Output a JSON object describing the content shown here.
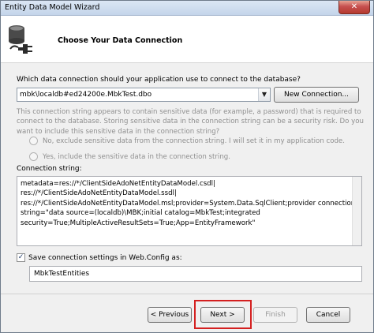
{
  "window": {
    "title": "Entity Data Model Wizard",
    "close_glyph": "✕"
  },
  "header": {
    "title": "Choose Your Data Connection",
    "icon": "database-connection-icon"
  },
  "connection": {
    "question": "Which data connection should your application use to connect to the database?",
    "selected": "mbk\\localdb#ed24200e.MbkTest.dbo",
    "dropdown_glyph": "▼",
    "new_connection_label": "New Connection...",
    "warning": "This connection string appears to contain sensitive data (for example, a password) that is required to connect to the database. Storing sensitive data in the connection string can be a security risk. Do you want to include this sensitive data in the connection string?",
    "radio_no": "No, exclude sensitive data from the connection string. I will set it in my application code.",
    "radio_yes": "Yes, include the sensitive data in the connection string.",
    "string_label": "Connection string:",
    "string_lines": [
      "metadata=res://*/ClientSideAdoNetEntityDataModel.csdl|",
      "res://*/ClientSideAdoNetEntityDataModel.ssdl|",
      "res://*/ClientSideAdoNetEntityDataModel.msl;provider=System.Data.SqlClient;provider connection",
      "string=\"data source=(localdb)\\MBK;initial catalog=MbkTest;integrated",
      "security=True;MultipleActiveResultSets=True;App=EntityFramework\""
    ]
  },
  "save": {
    "checked": true,
    "check_glyph": "✓",
    "label": "Save connection settings in Web.Config as:",
    "value": "MbkTestEntities"
  },
  "buttons": {
    "previous": "< Previous",
    "next": "Next >",
    "finish": "Finish",
    "cancel": "Cancel"
  },
  "colors": {
    "highlight": "#d42020",
    "accent": "#c75050"
  }
}
